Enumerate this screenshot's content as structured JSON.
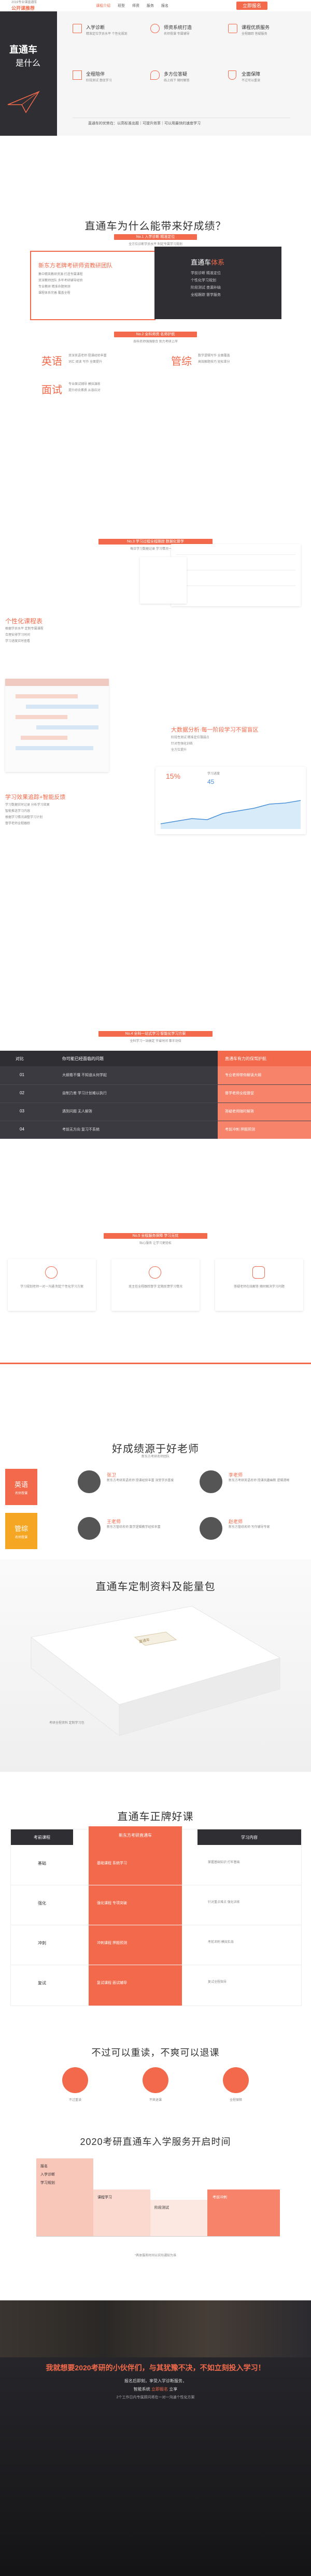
{
  "header": {
    "top_small": "2019专业课直通车",
    "brand": "公开课推荐",
    "nav": [
      "课程介绍",
      "班型",
      "师资",
      "服务",
      "报名"
    ],
    "cta": "立即报名"
  },
  "hero": {
    "logo_text": "直通车",
    "logo_sub": "是什么",
    "features": [
      {
        "title": "入学诊断",
        "desc": "精准定位学员水平 个性化规划"
      },
      {
        "title": "师资系统打造",
        "desc": "名师授课 专属辅导"
      },
      {
        "title": "课程优质服务",
        "desc": "全程跟踪 答疑服务"
      },
      {
        "title": "全程陪伴",
        "desc": "阶段测试 督促学习"
      },
      {
        "title": "多方位答疑",
        "desc": "线上线下 随时解答"
      },
      {
        "title": "全面保障",
        "desc": "不过可以重读"
      }
    ],
    "note": "直通车的优势在：以高标准出题｜可提升效率｜可以用最快的速度学习"
  },
  "why": {
    "title": "直通车为什么能带来好成绩？",
    "tag1": "No.1 入学诊断 精准定位",
    "sub": "全方位诊断学员水平 制定专属学习规划",
    "left_title": "新东方老牌考研师资教研团队",
    "left_lines": [
      "集中精英教研资源 打造专属课程",
      "资深教师团队 多年考研辅导经验",
      "专业教研 精准命题预测",
      "课程体系完善 覆盖全程"
    ],
    "dark_title": "直通车",
    "dark_title2": "体系",
    "dark_lines": [
      "学前诊断 精准定位",
      "个性化学习规划",
      "阶段测试 查漏补缺",
      "全程跟踪 督学服务"
    ],
    "tag2": "No.2 全科师资 名师护航",
    "subjects_sub": "各科名师强强联合 助力考研上岸",
    "subjects": [
      {
        "name": "英语",
        "line1": "资深英语老师 授课经验丰富",
        "line2": "词汇 阅读 写作 全面提升"
      },
      {
        "name": "管综",
        "line1": "数学逻辑写作 全面覆盖",
        "line2": "高效解题技巧 轻松拿分"
      },
      {
        "name": "面试",
        "line1": "专业面试辅导 模拟演练",
        "line2": "提升综合素质 从容应对"
      }
    ]
  },
  "study": {
    "tag": "No.3 学习过程全程跟踪 数据化督学",
    "sub": "每日学习数据记录 学习情况一目了然",
    "block1_title": "个性化课程表",
    "block1_lines": [
      "根据学员水平 定制专属课程",
      "合理安排学习时间",
      "学习进度实时查看"
    ],
    "block2_title": "大数据分析·每一阶段学习不留盲区",
    "block2_lines": [
      "阶段性测试 精准定位薄弱点",
      "针对性强化训练",
      "全方位提升"
    ],
    "block3_title": "学习效果追踪+智能反馈",
    "block3_lines": [
      "学习数据实时记录 分析学习效果",
      "智能推送学习内容",
      "根据学习情况调整学习计划",
      "督学老师全程跟踪"
    ],
    "chart_percent": "15%",
    "chart_label": "学习进度",
    "chart_value": "45"
  },
  "compare": {
    "tag": "No.4 全科一站式学习 智能化学习方案",
    "sub": "全科学习一站搞定 节省时间 事半功倍",
    "headers": [
      "对比",
      "你可能已经面临的问题",
      "直通车有力的保驾护航"
    ],
    "rows": [
      {
        "k": "01",
        "a": "大纲看不懂 不知道从何学起",
        "b": "专业老师带你解读大纲"
      },
      {
        "k": "02",
        "a": "自制力差 学习计划难以执行",
        "b": "督学老师全程督促"
      },
      {
        "k": "03",
        "a": "遇到问题 无人解答",
        "b": "答疑老师随时解答"
      },
      {
        "k": "04",
        "a": "考前无方向 复习不系统",
        "b": "考前冲刺 押题预测"
      }
    ]
  },
  "service": {
    "tag": "No.5 全程服务保障 学习无忧",
    "sub": "贴心服务 让学习更轻松",
    "cards": [
      {
        "text": "学习规划老师一对一沟通 制定个性化学习方案"
      },
      {
        "text": "班主任全程跟踪督学 定期反馈学习情况"
      },
      {
        "text": "答疑老师在线解答 随时解决学习问题"
      }
    ]
  },
  "teachers": {
    "title": "好成绩源于好老师",
    "sub": "新东方考研名师团队",
    "groups": [
      {
        "name": "英语",
        "desc": "名师授课"
      },
      {
        "name": "管综",
        "desc": "名师授课"
      }
    ],
    "items": [
      {
        "name": "张卫",
        "desc": "新东方考研英语名师 授课经验丰富 深受学员喜爱"
      },
      {
        "name": "李老师",
        "desc": "新东方考研英语名师 授课风趣幽默 逻辑清晰"
      },
      {
        "name": "王老师",
        "desc": "新东方管综名师 数学逻辑教学经验丰富"
      },
      {
        "name": "赵老师",
        "desc": "新东方管综名师 写作辅导专家"
      }
    ]
  },
  "package": {
    "title": "直通车定制资料及能量包",
    "box_label": "直通车",
    "caption": "考研全程资料 定制学习包"
  },
  "courses": {
    "title": "直通车正牌好课",
    "header_left": "考前课程",
    "header_mid": "新东方考研直通车",
    "header_right": "学习内容",
    "rows": [
      {
        "k": "基础",
        "mid": "基础课程 系统学习",
        "r": "掌握基础知识 打牢基础"
      },
      {
        "k": "强化",
        "mid": "强化课程 专项突破",
        "r": "针对重点难点 强化训练"
      },
      {
        "k": "冲刺",
        "mid": "冲刺课程 押题预测",
        "r": "考前冲刺 模拟实战"
      },
      {
        "k": "复试",
        "mid": "复试课程 面试辅导",
        "r": "复试全程指导"
      }
    ]
  },
  "guarantee": {
    "title": "不过可以重读，不爽可以退课",
    "items": [
      {
        "label": "不过重读"
      },
      {
        "label": "不爽退课"
      },
      {
        "label": "全程保障"
      }
    ]
  },
  "timeline": {
    "title": "2020考研直通车入学服务开启时间",
    "stages": [
      "报名",
      "入学诊断",
      "学习规划",
      "课程学习",
      "阶段测试",
      "考前冲刺"
    ],
    "note": "*具体服务时间以实际通知为准"
  },
  "footer": {
    "headline": "我就想要2020考研的小伙伴们，与其犹豫不决，不如立刻投入学习！",
    "line1": "报名后即刻，享受入学诊断服务，",
    "line2_prefix": "智能系统",
    "line2_highlight": "立即报名",
    "line2_suffix": "立享",
    "line3": "2个工作日内专属顾问将在一对一沟通个性化方案"
  },
  "colors": {
    "accent": "#f26a4b",
    "dark": "#2e2e33"
  }
}
